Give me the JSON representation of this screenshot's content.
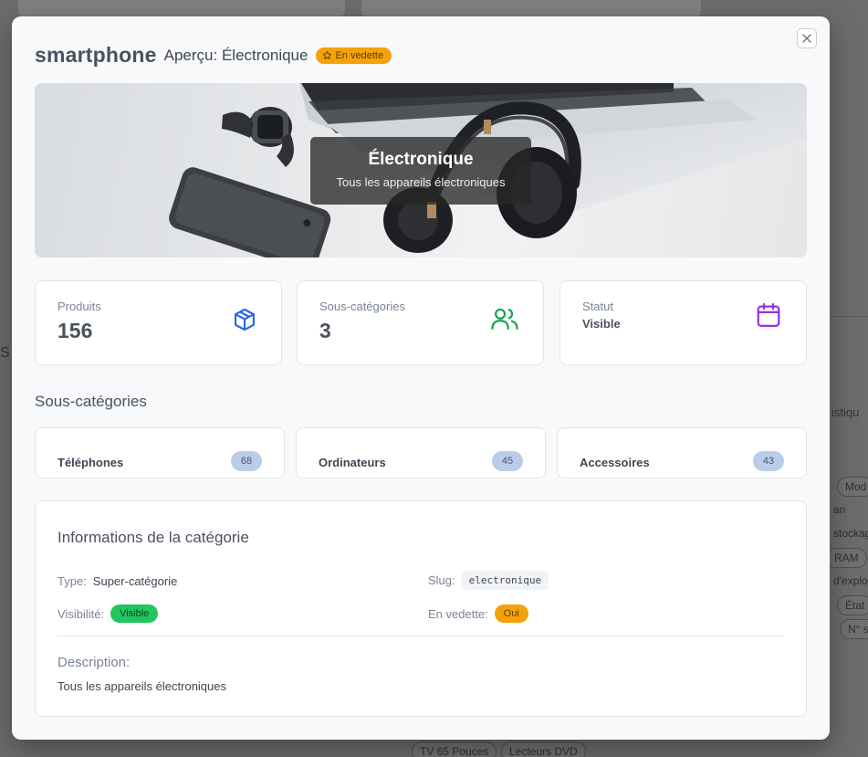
{
  "background": {
    "right_text_1": "istiqu",
    "left_text": "S",
    "chips": [
      "Mod",
      "an",
      "stockag",
      "RAM",
      "d'explo",
      "État",
      "N° s",
      "TV 65 Pouces",
      "Lecteurs DVD"
    ]
  },
  "modal": {
    "title": "smartphone",
    "subtitle": "Aperçu: Électronique",
    "featured_badge": "En vedette",
    "hero": {
      "heading": "Électronique",
      "caption": "Tous les appareils électroniques"
    },
    "stats": [
      {
        "label": "Produits",
        "value": "156",
        "icon": "cube-icon"
      },
      {
        "label": "Sous-catégories",
        "value": "3",
        "icon": "users-icon"
      },
      {
        "label": "Statut",
        "value": "Visible",
        "icon": "calendar-icon"
      }
    ],
    "subcategories_title": "Sous-catégories",
    "subcategories": [
      {
        "name": "Téléphones",
        "count": "68"
      },
      {
        "name": "Ordinateurs",
        "count": "45"
      },
      {
        "name": "Accessoires",
        "count": "43"
      }
    ],
    "info": {
      "title": "Informations de la catégorie",
      "type_label": "Type:",
      "type_value": "Super-catégorie",
      "slug_label": "Slug:",
      "slug_value": "electronique",
      "visibility_label": "Visibilité:",
      "visibility_value": "Visible",
      "featured_label": "En vedette:",
      "featured_value": "Oui",
      "description_label": "Description:",
      "description_value": "Tous les appareils électroniques"
    },
    "colors": {
      "accent_amber": "#f4a20c",
      "success_green": "#22c55e",
      "icon_blue": "#2563eb",
      "icon_green": "#16a34a",
      "icon_purple": "#9333ea"
    }
  }
}
